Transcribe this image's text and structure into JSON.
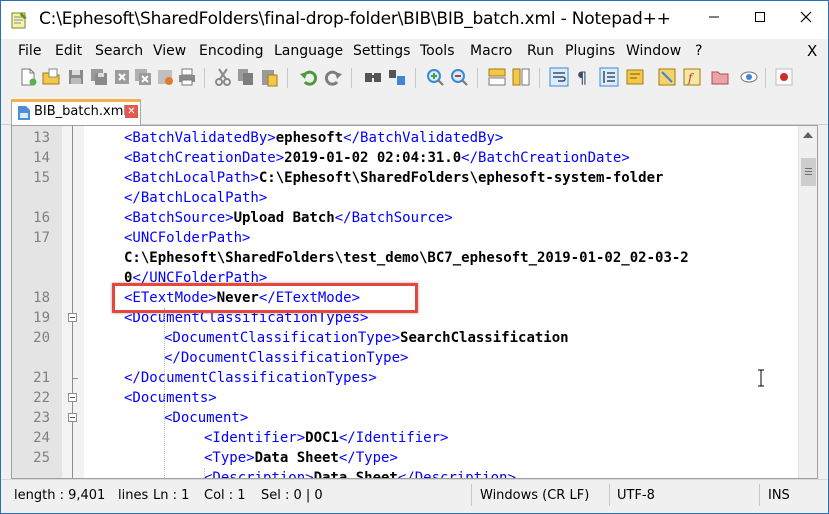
{
  "window": {
    "title": "C:\\Ephesoft\\SharedFolders\\final-drop-folder\\BIB\\BIB_batch.xml - Notepad++",
    "buttons": [
      "minimize",
      "maximize",
      "close"
    ]
  },
  "menu": {
    "items": [
      "File",
      "Edit",
      "Search",
      "View",
      "Encoding",
      "Language",
      "Settings",
      "Tools",
      "Macro",
      "Run",
      "Plugins",
      "Window",
      "?"
    ],
    "close_label": "X"
  },
  "toolbar": {
    "icons": [
      "new-file-icon",
      "open-file-icon",
      "save-icon",
      "save-all-icon",
      "close-icon",
      "close-all-icon",
      "print-icon",
      "cut-icon",
      "copy-icon",
      "paste-icon",
      "undo-icon",
      "redo-icon",
      "find-icon",
      "replace-icon",
      "zoom-in-icon",
      "zoom-out-icon",
      "sync-vertical-icon",
      "sync-horizontal-icon",
      "word-wrap-icon",
      "show-all-characters-icon",
      "indent-guide-icon",
      "user-defined-language-icon",
      "document-map-icon",
      "function-list-icon",
      "folder-as-workspace-icon",
      "monitoring-icon",
      "record-macro-icon"
    ]
  },
  "tab": {
    "label": "BIB_batch.xml",
    "close_glyph": "✕"
  },
  "editor": {
    "lines": [
      {
        "num": "13",
        "indent": 1,
        "open": "<BatchValidatedBy>",
        "value": "ephesoft",
        "close": "</BatchValidatedBy>"
      },
      {
        "num": "14",
        "indent": 1,
        "open": "<BatchCreationDate>",
        "value": "2019-01-02 02:04:31.0",
        "close": "</BatchCreationDate>"
      },
      {
        "num": "15",
        "indent": 1,
        "open": "<BatchLocalPath>",
        "value": "C:\\Ephesoft\\SharedFolders\\ephesoft-system-folder",
        "close": ""
      },
      {
        "num": "",
        "indent": 1,
        "open": "</BatchLocalPath>",
        "value": "",
        "close": ""
      },
      {
        "num": "16",
        "indent": 1,
        "open": "<BatchSource>",
        "value": "Upload Batch",
        "close": "</BatchSource>"
      },
      {
        "num": "17",
        "indent": 1,
        "open": "<UNCFolderPath>",
        "value": "",
        "close": ""
      },
      {
        "num": "",
        "indent": 1,
        "open": "",
        "value": "C:\\Ephesoft\\SharedFolders\\test_demo\\BC7_ephesoft_2019-01-02_02-03-2",
        "close": ""
      },
      {
        "num": "",
        "indent": 1,
        "open": "",
        "value": "0",
        "close": "</UNCFolderPath>"
      },
      {
        "num": "18",
        "indent": 1,
        "open": "<ETextMode>",
        "value": "Never",
        "close": "</ETextMode>"
      },
      {
        "num": "19",
        "indent": 1,
        "open": "<DocumentClassificationTypes>",
        "value": "",
        "close": ""
      },
      {
        "num": "20",
        "indent": 2,
        "open": "<DocumentClassificationType>",
        "value": "SearchClassification",
        "close": ""
      },
      {
        "num": "",
        "indent": 2,
        "open": "</DocumentClassificationType>",
        "value": "",
        "close": ""
      },
      {
        "num": "21",
        "indent": 1,
        "open": "</DocumentClassificationTypes>",
        "value": "",
        "close": ""
      },
      {
        "num": "22",
        "indent": 1,
        "open": "<Documents>",
        "value": "",
        "close": ""
      },
      {
        "num": "23",
        "indent": 2,
        "open": "<Document>",
        "value": "",
        "close": ""
      },
      {
        "num": "24",
        "indent": 3,
        "open": "<Identifier>",
        "value": "DOC1",
        "close": "</Identifier>"
      },
      {
        "num": "25",
        "indent": 3,
        "open": "<Type>",
        "value": "Data Sheet",
        "close": "</Type>"
      },
      {
        "num": "",
        "indent": 3,
        "open": "<Description>",
        "value": "Data Sheet",
        "close": "</Description>"
      }
    ]
  },
  "status": {
    "length": "length : 9,401",
    "lines": "lines",
    "ln": "Ln : 1",
    "col": "Col : 1",
    "sel": "Sel : 0 | 0",
    "eol": "Windows (CR LF)",
    "encoding": "UTF-8",
    "mode": "INS"
  },
  "colors": {
    "tag": "#0000ff",
    "highlight_box": "#e4473b",
    "tab_accent": "#f5b14b"
  }
}
